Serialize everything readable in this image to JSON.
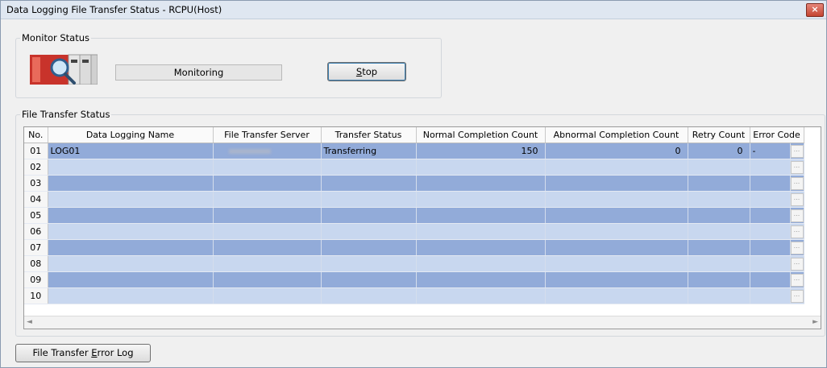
{
  "window": {
    "title": "Data Logging File Transfer Status - RCPU(Host)",
    "close_label": "×"
  },
  "monitor": {
    "group_label": "Monitor Status",
    "status_text": "Monitoring",
    "stop_label_key": "S",
    "stop_label_rest": "top"
  },
  "transfer": {
    "group_label": "File Transfer Status",
    "columns": [
      "No.",
      "Data Logging Name",
      "File Transfer Server",
      "Transfer Status",
      "Normal Completion Count",
      "Abnormal Completion Count",
      "Retry Count",
      "Error Code"
    ],
    "rows": [
      {
        "no": "01",
        "name": "LOG01",
        "server": "",
        "status": "Transferring",
        "normal": "150",
        "abnormal": "0",
        "retry": "0",
        "error": "-"
      },
      {
        "no": "02",
        "name": "",
        "server": "",
        "status": "",
        "normal": "",
        "abnormal": "",
        "retry": "",
        "error": ""
      },
      {
        "no": "03",
        "name": "",
        "server": "",
        "status": "",
        "normal": "",
        "abnormal": "",
        "retry": "",
        "error": ""
      },
      {
        "no": "04",
        "name": "",
        "server": "",
        "status": "",
        "normal": "",
        "abnormal": "",
        "retry": "",
        "error": ""
      },
      {
        "no": "05",
        "name": "",
        "server": "",
        "status": "",
        "normal": "",
        "abnormal": "",
        "retry": "",
        "error": ""
      },
      {
        "no": "06",
        "name": "",
        "server": "",
        "status": "",
        "normal": "",
        "abnormal": "",
        "retry": "",
        "error": ""
      },
      {
        "no": "07",
        "name": "",
        "server": "",
        "status": "",
        "normal": "",
        "abnormal": "",
        "retry": "",
        "error": ""
      },
      {
        "no": "08",
        "name": "",
        "server": "",
        "status": "",
        "normal": "",
        "abnormal": "",
        "retry": "",
        "error": ""
      },
      {
        "no": "09",
        "name": "",
        "server": "",
        "status": "",
        "normal": "",
        "abnormal": "",
        "retry": "",
        "error": ""
      },
      {
        "no": "10",
        "name": "",
        "server": "",
        "status": "",
        "normal": "",
        "abnormal": "",
        "retry": "",
        "error": ""
      }
    ],
    "detail_button_label": "...",
    "scroll_left": "◄",
    "scroll_right": "►"
  },
  "footer": {
    "log_button_pre": "File Transfer ",
    "log_button_key": "E",
    "log_button_post": "rror Log"
  },
  "colors": {
    "row_dark": "#92abd9",
    "row_light": "#c8d7ef",
    "header_bg": "#fafafa"
  }
}
